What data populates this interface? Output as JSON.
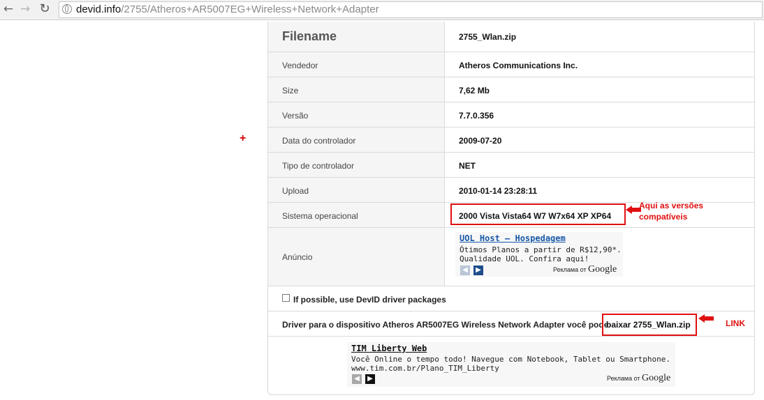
{
  "browser": {
    "url_host": "devid.info",
    "url_path": "/2755/Atheros+AR5007EG+Wireless+Network+Adapter"
  },
  "rows": [
    {
      "label": "Filename",
      "value": "2755_Wlan.zip"
    },
    {
      "label": "Vendedor",
      "value": "Atheros Communications Inc."
    },
    {
      "label": "Size",
      "value": "7,62 Mb"
    },
    {
      "label": "Versão",
      "value": "7.7.0.356"
    },
    {
      "label": "Data do controlador",
      "value": "2009-07-20"
    },
    {
      "label": "Tipo de controlador",
      "value": "NET"
    },
    {
      "label": "Upload",
      "value": "2010-01-14 23:28:11"
    },
    {
      "label": "Sistema operacional",
      "value": "2000 Vista Vista64 W7 W7x64 XP XP64"
    }
  ],
  "ad_row": {
    "label": "Anúncio",
    "title": "UOL Host – Hospedagem",
    "line1": "Ótimos Planos a partir de R$12,90*.",
    "line2": "Qualidade UOL. Confira aqui!",
    "brand_prefix": "Реклама от",
    "brand": "Google"
  },
  "checkbox_row": {
    "label": "If possible, use DevID driver packages",
    "checked": false
  },
  "driver_row": {
    "text": "Driver para o dispositivo Atheros AR5007EG Wireless Network Adapter você pode",
    "link": "baixar 2755_Wlan.zip"
  },
  "bottom_ad": {
    "title": "TIM Liberty Web",
    "line1": "Você Online o tempo todo! Navegue com Notebook, Tablet ou Smartphone.",
    "line2": "www.tim.com.br/Plano_TIM_Liberty",
    "brand_prefix": "Реклама от",
    "brand": "Google"
  },
  "annotations": {
    "versions_note_1": "Aqui as versões",
    "versions_note_2": "compatíveis",
    "link_note": "LINK",
    "plus": "+",
    "color": "#e01010"
  },
  "icons": [
    "back-icon",
    "forward-icon",
    "reload-icon",
    "globe-icon",
    "chevron-left-icon",
    "chevron-right-icon"
  ]
}
